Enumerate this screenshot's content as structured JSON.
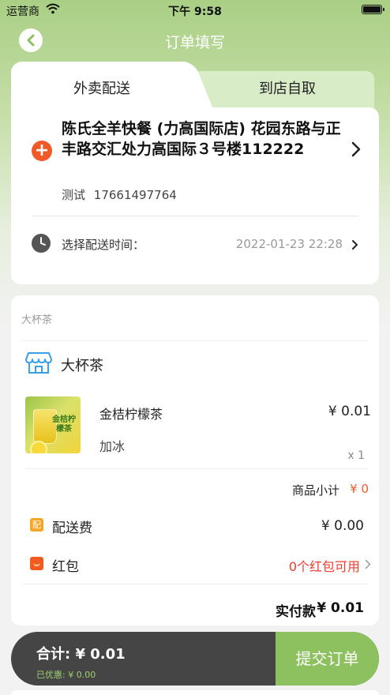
{
  "status_bar": {
    "carrier": "运营商",
    "time": "下午 9:58"
  },
  "nav": {
    "title": "订单填写"
  },
  "tabs": [
    {
      "label": "外卖配送",
      "active": true
    },
    {
      "label": "到店自取",
      "active": false
    }
  ],
  "address": {
    "text": "陈氏全羊快餐 (力高国际店) 花园东路与正丰路交汇处力高国际３号楼112222",
    "contact_name": "测试",
    "contact_phone": "17661497764"
  },
  "delivery_time": {
    "label": "选择配送时间：",
    "value": "2022-01-23 22:28"
  },
  "order": {
    "category": "大杯茶",
    "shop_name": "大杯茶",
    "items": [
      {
        "image_label": "金桔柠檬茶",
        "name": "金桔柠檬茶",
        "price": "¥ 0.01",
        "spec": "加冰",
        "qty": "x 1"
      }
    ],
    "subtotal_label": "商品小计",
    "subtotal_value": "¥ 0",
    "delivery_fee_icon": "配",
    "delivery_fee_label": "配送费",
    "delivery_fee_value": "¥ 0.00",
    "red_packet_label": "红包",
    "red_packet_value": "0个红包可用",
    "pay_label": "实付款",
    "pay_value": "¥ 0.01"
  },
  "bottom": {
    "total": "合计: ¥ 0.01",
    "discount": "已优惠: ¥ 0.00",
    "submit": "提交订单"
  },
  "colors": {
    "accent_green": "#8dc05f",
    "orange": "#f05a28",
    "red": "#f03b2b",
    "dark_bar": "#454545"
  },
  "icons": [
    "wifi-icon",
    "battery-icon",
    "back-icon",
    "add-address-icon",
    "chevron-right-icon",
    "clock-icon",
    "shop-icon",
    "delivery-fee-icon",
    "red-packet-icon"
  ]
}
